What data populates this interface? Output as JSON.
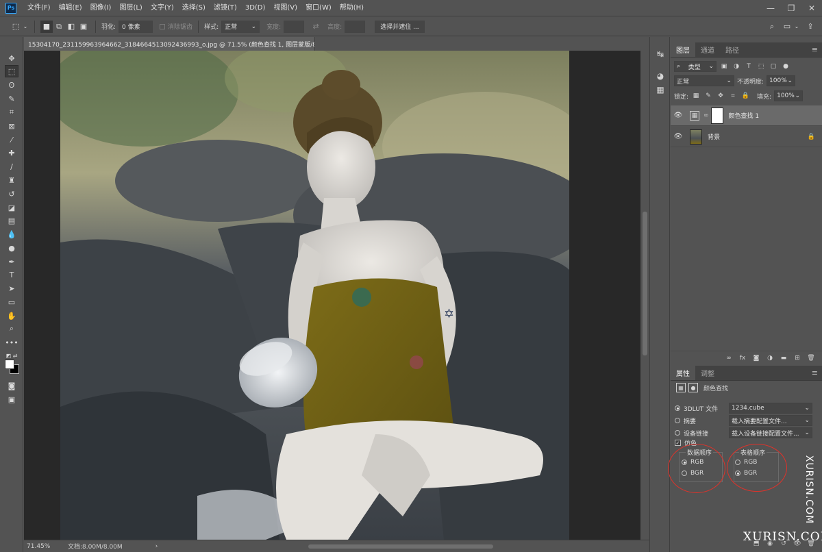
{
  "app": {
    "logo": "Ps",
    "menu": [
      "文件(F)",
      "编辑(E)",
      "图像(I)",
      "图层(L)",
      "文字(Y)",
      "选择(S)",
      "滤镜(T)",
      "3D(D)",
      "视图(V)",
      "窗口(W)",
      "帮助(H)"
    ]
  },
  "options_bar": {
    "feather_label": "羽化:",
    "feather_value": "0 像素",
    "antialias_label": "消除锯齿",
    "style_label": "样式:",
    "style_value": "正常",
    "width_label": "宽度:",
    "height_label": "高度:",
    "select_mask_button": "选择并遮住 ..."
  },
  "document": {
    "tab_title": "15304170_231159963964662_3184664513092436993_o.jpg @ 71.5% (颜色查找 1, 图层蒙版/8) *",
    "zoom": "71.45%",
    "doc_size": "文档:8.00M/8.00M"
  },
  "layers_panel": {
    "tabs": [
      "图层",
      "通道",
      "路径"
    ],
    "filter_kind": "类型",
    "blend_mode": "正常",
    "opacity_label": "不透明度:",
    "opacity_value": "100%",
    "lock_label": "锁定:",
    "fill_label": "填充:",
    "fill_value": "100%",
    "layers": [
      {
        "name": "颜色查找 1",
        "type": "adjustment",
        "visible": true,
        "selected": true
      },
      {
        "name": "背景",
        "type": "image",
        "visible": true,
        "locked": true,
        "selected": false
      }
    ]
  },
  "properties_panel": {
    "tabs": [
      "属性",
      "调整"
    ],
    "title": "颜色查找",
    "lut3d_label": "3DLUT 文件",
    "lut3d_value": "1234.cube",
    "abstract_label": "摘要",
    "abstract_value": "载入摘要配置文件...",
    "devicelink_label": "设备链接",
    "devicelink_value": "载入设备链接配置文件...",
    "dither_label": "仿色",
    "data_order_label": "数据顺序",
    "table_order_label": "表格顺序",
    "data_order_options": [
      "RGB",
      "BGR"
    ],
    "table_order_options": [
      "RGB",
      "BGR"
    ],
    "data_order_selected": "RGB",
    "table_order_selected": "BGR"
  },
  "watermark": {
    "vertical": "XURISN.COM",
    "horizontal": "XURISN.COM"
  },
  "colors": {
    "ui_bg": "#535353",
    "canvas_bg": "#282828",
    "highlight_circle": "#e0322a"
  }
}
